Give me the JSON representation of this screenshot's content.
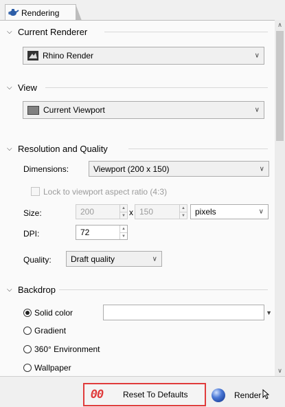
{
  "tab": {
    "label": "Rendering",
    "icon": "teapot-icon"
  },
  "sections": {
    "renderer": {
      "title": "Current Renderer",
      "value": "Rhino Render",
      "icon": "rhino-render-icon"
    },
    "view": {
      "title": "View",
      "value": "Current Viewport",
      "icon": "viewport-icon"
    },
    "resolution": {
      "title": "Resolution and Quality",
      "dimensions_label": "Dimensions:",
      "dimensions_value": "Viewport (200 x 150)",
      "lock_label": "Lock to viewport aspect ratio (4:3)",
      "size_label": "Size:",
      "width": "200",
      "x_label": "x",
      "height": "150",
      "units": "pixels",
      "dpi_label": "DPI:",
      "dpi": "72",
      "quality_label": "Quality:",
      "quality_value": "Draft quality"
    },
    "backdrop": {
      "title": "Backdrop",
      "options": [
        "Solid color",
        "Gradient",
        "360° Environment",
        "Wallpaper"
      ],
      "selected": "Solid color",
      "color_hex": "#ffffff"
    }
  },
  "footer": {
    "reset_label": "Reset To Defaults",
    "reset_icon": "00",
    "render_label": "Render"
  },
  "colors": {
    "highlight": "#e03b3b"
  }
}
